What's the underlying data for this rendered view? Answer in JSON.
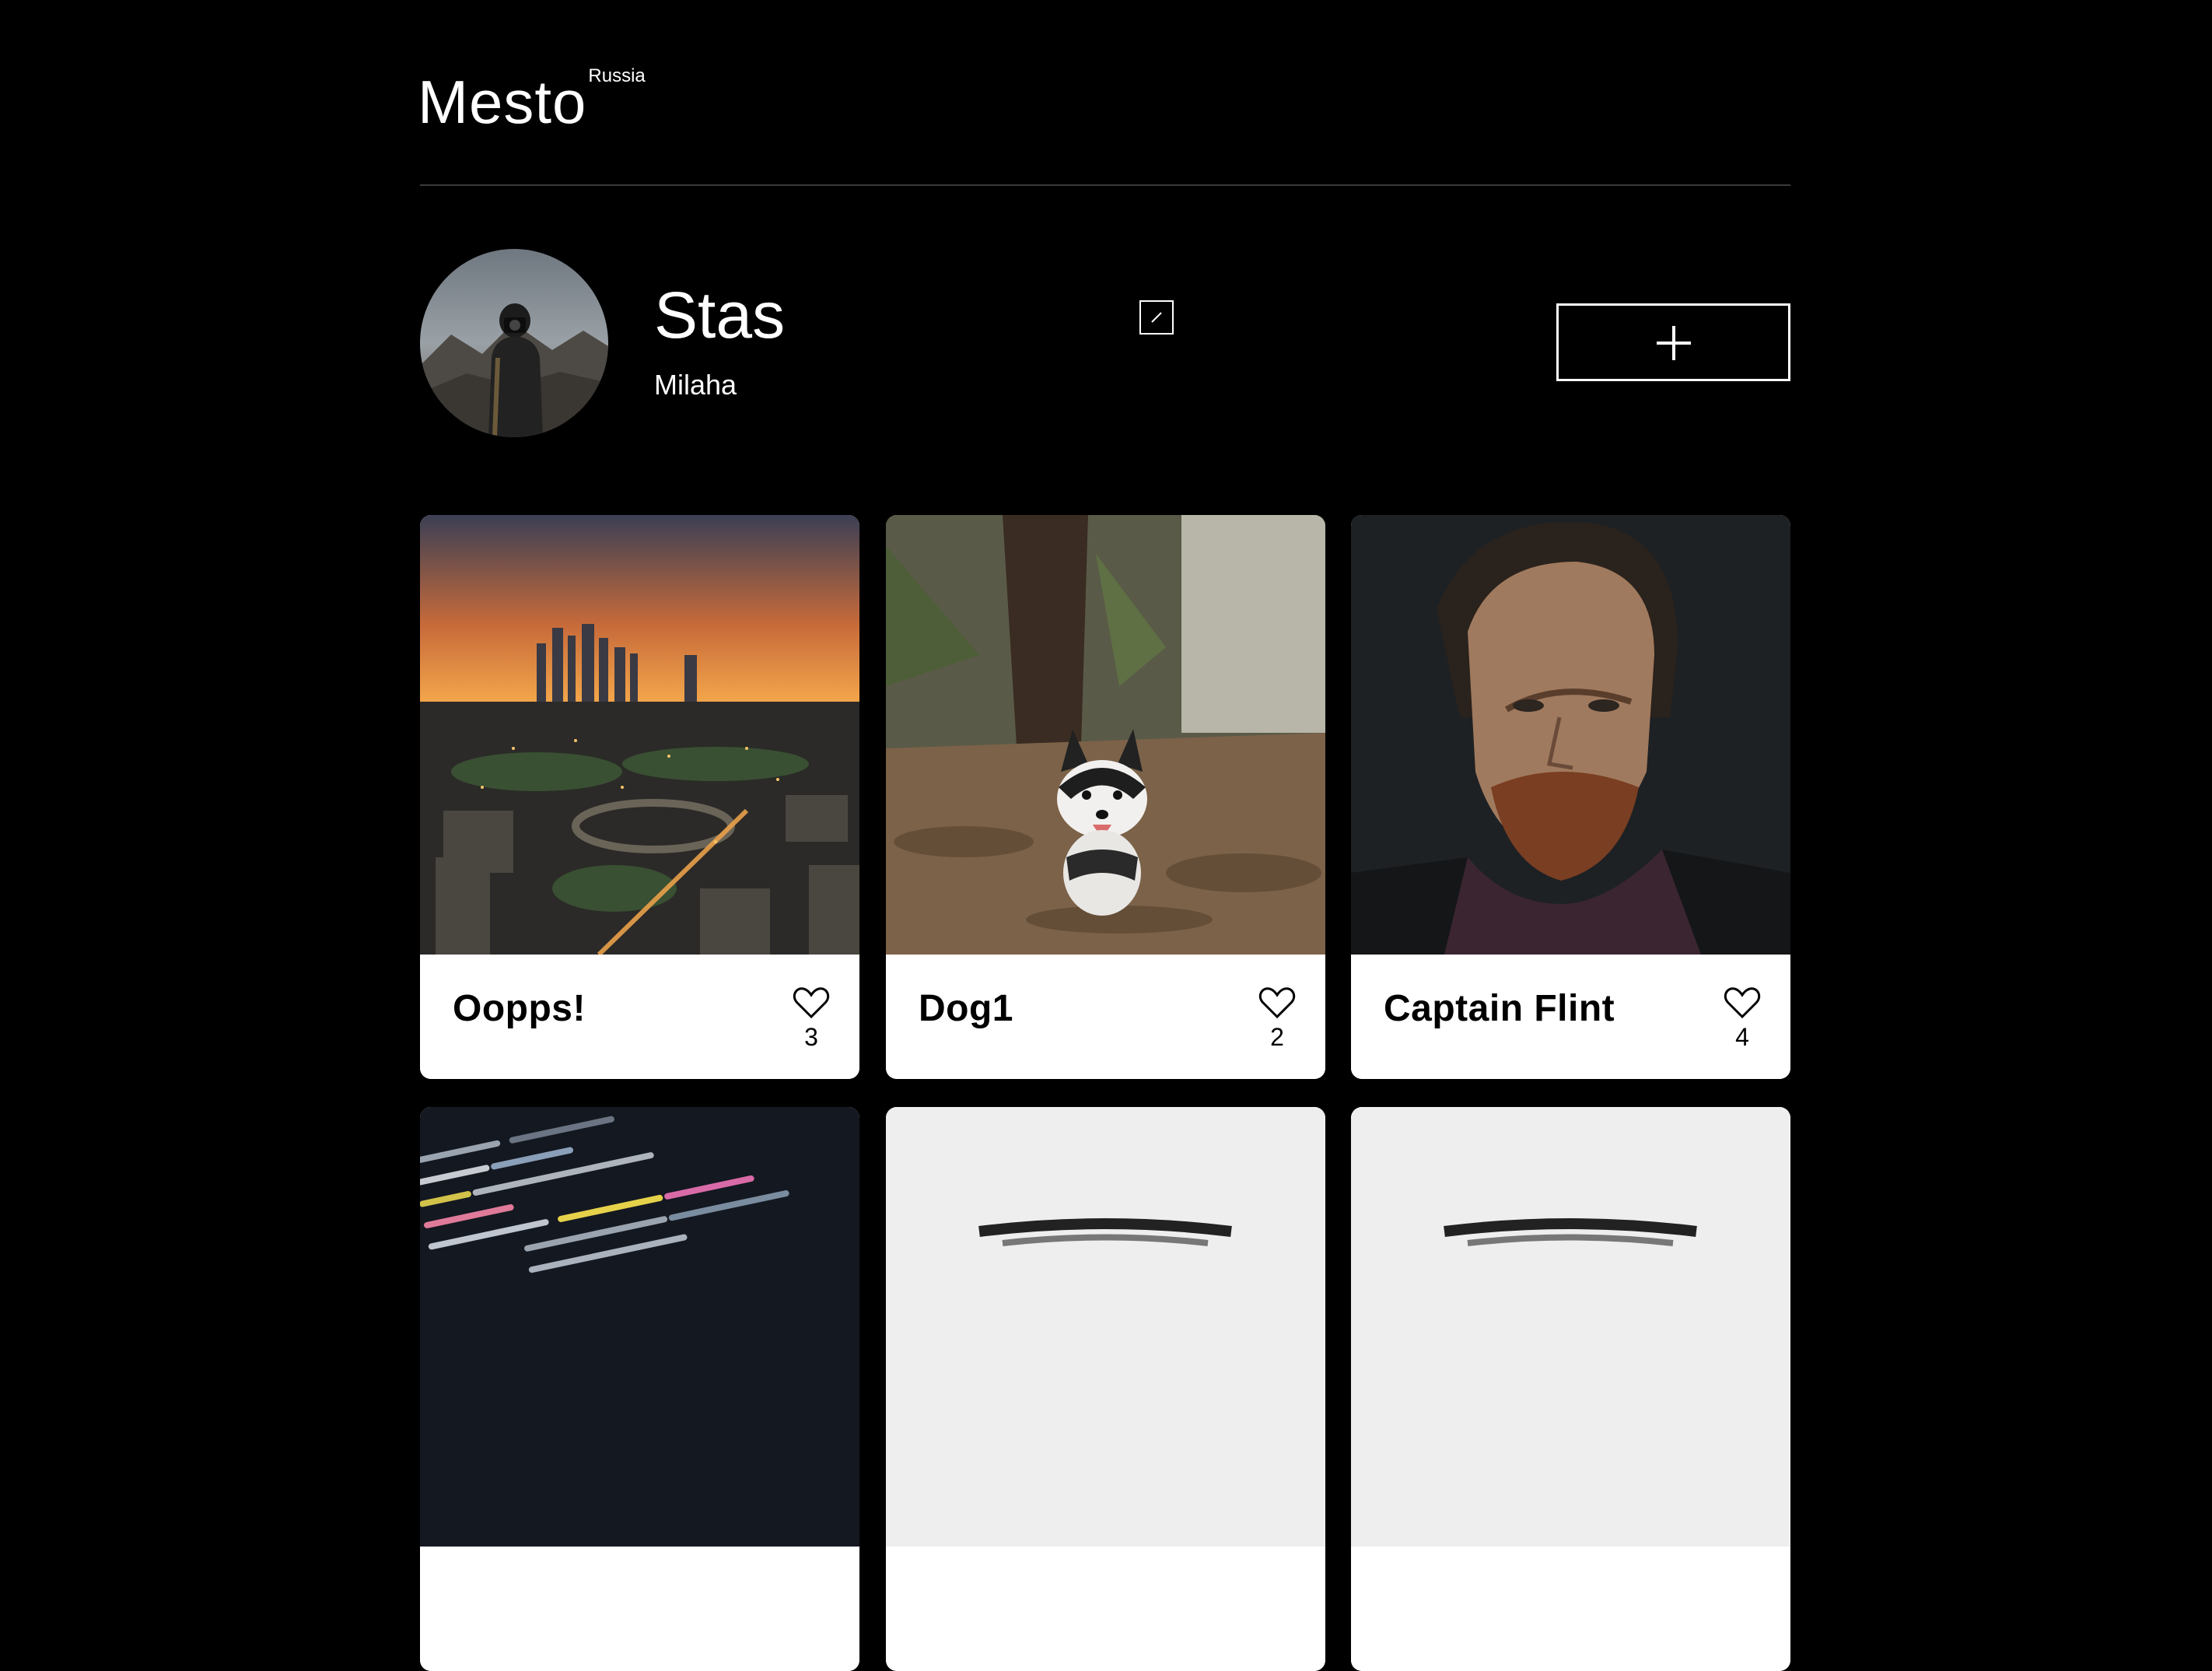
{
  "header": {
    "logo": "Mesto",
    "logo_sup": "Russia"
  },
  "profile": {
    "name": "Stas",
    "about": "Milaha",
    "avatar_icon": "avatar-photographer"
  },
  "cards": [
    {
      "title": "Oopps!",
      "likes": "3",
      "image": "city-sunset-image"
    },
    {
      "title": "Dog1",
      "likes": "2",
      "image": "husky-puppy-image"
    },
    {
      "title": "Captain Flint",
      "likes": "4",
      "image": "pirate-portrait-image"
    },
    {
      "title": "",
      "likes": "",
      "image": "code-screen-image"
    },
    {
      "title": "",
      "likes": "",
      "image": "placeholder-image"
    },
    {
      "title": "",
      "likes": "",
      "image": "placeholder-image"
    }
  ],
  "colors": {
    "background": "#000000",
    "text": "#ffffff",
    "card": "#ffffff",
    "card_text": "#000000",
    "divider": "#545454"
  }
}
